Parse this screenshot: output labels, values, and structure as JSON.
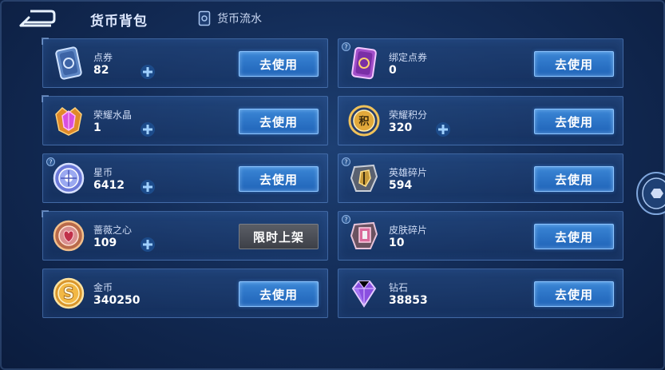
{
  "header": {
    "title": "货币背包",
    "flow_tab_label": "货币流水"
  },
  "cards": [
    {
      "name": "点券",
      "amount": "82",
      "button": "去使用",
      "icon": "ticket-icon",
      "has_plus": true
    },
    {
      "name": "绑定点券",
      "amount": "0",
      "button": "去使用",
      "icon": "bound-ticket-icon",
      "has_plus": false
    },
    {
      "name": "荣耀水晶",
      "amount": "1",
      "button": "去使用",
      "icon": "glory-crystal-icon",
      "has_plus": true
    },
    {
      "name": "荣耀积分",
      "amount": "320",
      "button": "去使用",
      "icon": "glory-points-icon",
      "has_plus": true
    },
    {
      "name": "星币",
      "amount": "6412",
      "button": "去使用",
      "icon": "star-coin-icon",
      "has_plus": true
    },
    {
      "name": "英雄碎片",
      "amount": "594",
      "button": "去使用",
      "icon": "hero-fragment-icon",
      "has_plus": false
    },
    {
      "name": "蔷薇之心",
      "amount": "109",
      "button": "限时上架",
      "icon": "rose-heart-icon",
      "has_plus": true
    },
    {
      "name": "皮肤碎片",
      "amount": "10",
      "button": "去使用",
      "icon": "skin-fragment-icon",
      "has_plus": false
    },
    {
      "name": "金币",
      "amount": "340250",
      "button": "去使用",
      "icon": "gold-coin-icon",
      "has_plus": false
    },
    {
      "name": "钻石",
      "amount": "38853",
      "button": "去使用",
      "icon": "diamond-icon",
      "has_plus": false
    }
  ],
  "colors": {
    "button_blue": "#2a74c8",
    "button_disabled": "#4a4e56",
    "card_border": "#6ea0e6"
  }
}
